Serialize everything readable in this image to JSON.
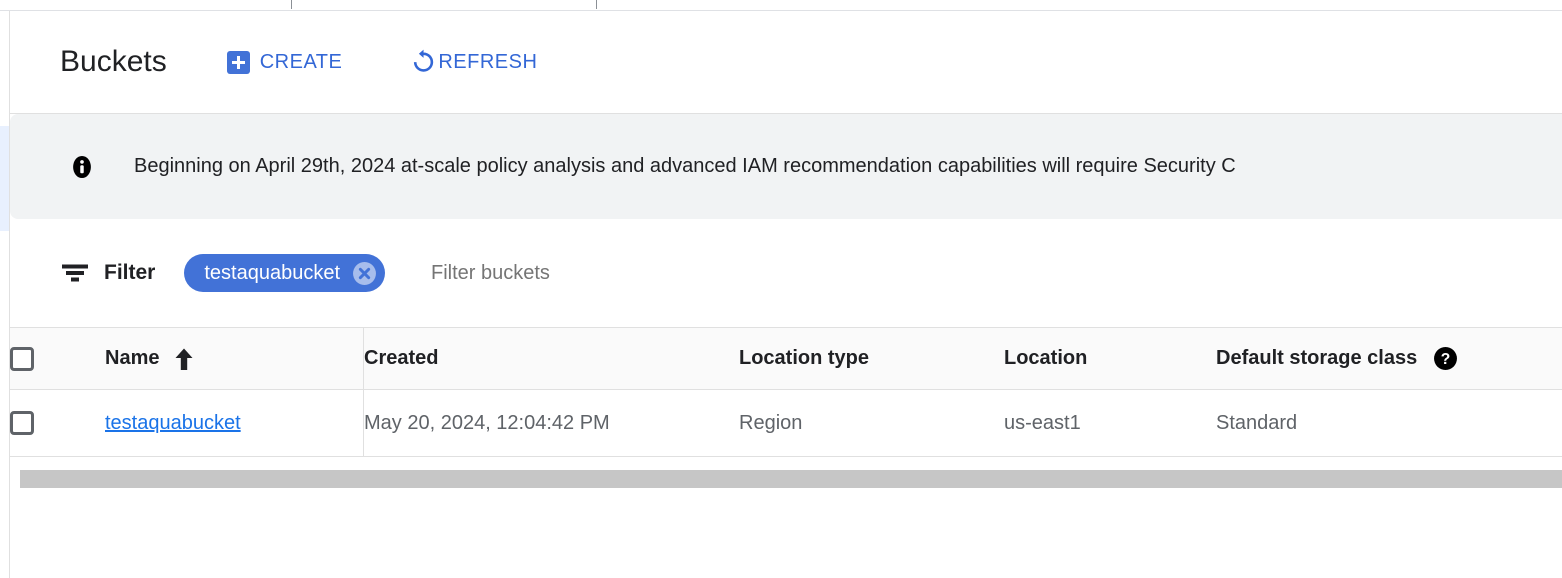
{
  "window": {
    "tabs_visible": 2
  },
  "header": {
    "title": "Buckets",
    "create_label": "CREATE",
    "refresh_label": "REFRESH",
    "create_icon": "plus-box-icon",
    "refresh_icon": "refresh-icon",
    "accent_color": "#3367d6",
    "create_icon_color": "#4272d7"
  },
  "banner": {
    "icon": "info-icon",
    "text": "Beginning on April 29th, 2024 at-scale policy analysis and advanced IAM recommendation capabilities will require Security C",
    "background": "#f1f3f4"
  },
  "filter": {
    "icon": "filter-icon",
    "label": "Filter",
    "chips": [
      {
        "label": "testaquabucket",
        "close_icon": "close-circle-icon",
        "color": "#4272d7"
      }
    ],
    "placeholder": "Filter buckets"
  },
  "table": {
    "select_all_checkbox": "unchecked",
    "columns": [
      {
        "label": "Name",
        "sort": "asc",
        "sort_icon": "arrow-up-icon"
      },
      {
        "label": "Created"
      },
      {
        "label": "Location type"
      },
      {
        "label": "Location"
      },
      {
        "label": "Default storage class",
        "help_icon": "help-icon"
      }
    ],
    "rows": [
      {
        "checkbox": "unchecked",
        "name": "testaquabucket",
        "created": "May 20, 2024, 12:04:42 PM",
        "location_type": "Region",
        "location": "us-east1",
        "default_storage_class": "Standard"
      }
    ]
  },
  "scrollbar": {
    "orientation": "horizontal",
    "thumb_color": "#c6c6c6"
  }
}
